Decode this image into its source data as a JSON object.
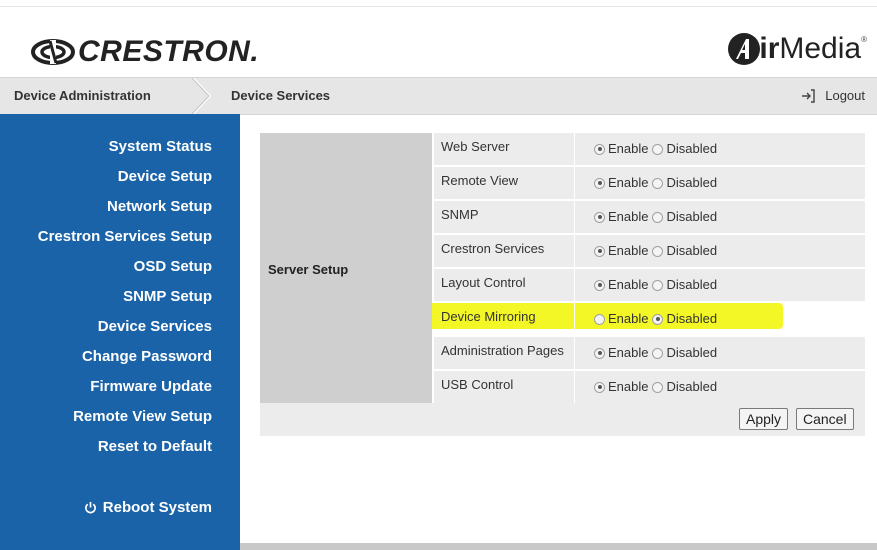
{
  "header": {
    "brand_left": "CRESTRON",
    "brand_left_suffix": ".",
    "brand_right_bold": "ir",
    "brand_right_thin": "Media",
    "brand_right_reg": "®"
  },
  "navbar": {
    "crumb_1": "Device Administration",
    "crumb_2": "Device Services",
    "logout": "Logout"
  },
  "sidebar": {
    "items": [
      {
        "label": "System Status"
      },
      {
        "label": "Device Setup"
      },
      {
        "label": "Network Setup"
      },
      {
        "label": "Crestron Services Setup"
      },
      {
        "label": "OSD Setup"
      },
      {
        "label": "SNMP Setup"
      },
      {
        "label": "Device Services"
      },
      {
        "label": "Change Password"
      },
      {
        "label": "Firmware Update"
      },
      {
        "label": "Remote View Setup"
      },
      {
        "label": "Reset to Default"
      }
    ],
    "reboot": "Reboot System"
  },
  "form": {
    "section_label": "Server Setup",
    "enable_label": "Enable",
    "disabled_label": "Disabled",
    "rows": [
      {
        "name": "Web Server",
        "value": "Enable"
      },
      {
        "name": "Remote View",
        "value": "Enable"
      },
      {
        "name": "SNMP",
        "value": "Enable"
      },
      {
        "name": "Crestron Services",
        "value": "Enable"
      },
      {
        "name": "Layout Control",
        "value": "Enable"
      },
      {
        "name": "Device Mirroring",
        "value": "Disabled"
      },
      {
        "name": "Administration Pages",
        "value": "Enable"
      },
      {
        "name": "USB Control",
        "value": "Enable"
      }
    ],
    "apply": "Apply",
    "cancel": "Cancel"
  },
  "colors": {
    "sidebar_bg": "#1a63a8",
    "highlight": "#f2f600"
  }
}
